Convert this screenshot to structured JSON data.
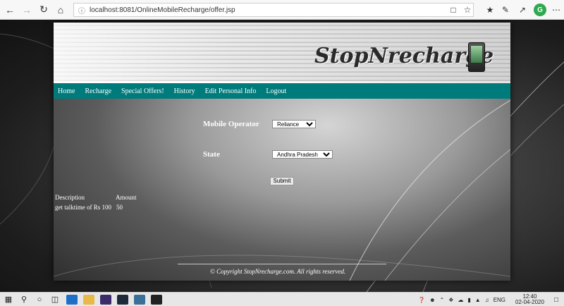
{
  "browser": {
    "url": "localhost:8081/OnlineMobileRecharge/offer.jsp",
    "back_icon": "back-arrow-icon",
    "forward_icon": "forward-arrow-icon",
    "refresh_icon": "refresh-icon",
    "home_icon": "home-icon"
  },
  "site": {
    "logo": "StopNrecharge",
    "menu": [
      "Home",
      "Recharge",
      "Special Offers!",
      "History",
      "Edit Personal Info",
      "Logout"
    ],
    "form": {
      "operator_label": "Mobile Operator",
      "operator_value": "Reliance",
      "state_label": "State",
      "state_value": "Andhra Pradesh",
      "submit_label": "Submit"
    },
    "table": {
      "headers": [
        "Description",
        "Amount"
      ],
      "rows": [
        {
          "description": "get talktime of Rs 100",
          "amount": "50"
        }
      ]
    },
    "footer": "© Copyright StopNrecharge.com. All rights reserved."
  },
  "taskbar": {
    "language": "ENG",
    "time": "12:40",
    "date": "02-04-2020"
  },
  "colors": {
    "menu_bg": "#007b7b",
    "taskbar_bg": "#e7e7e7"
  }
}
